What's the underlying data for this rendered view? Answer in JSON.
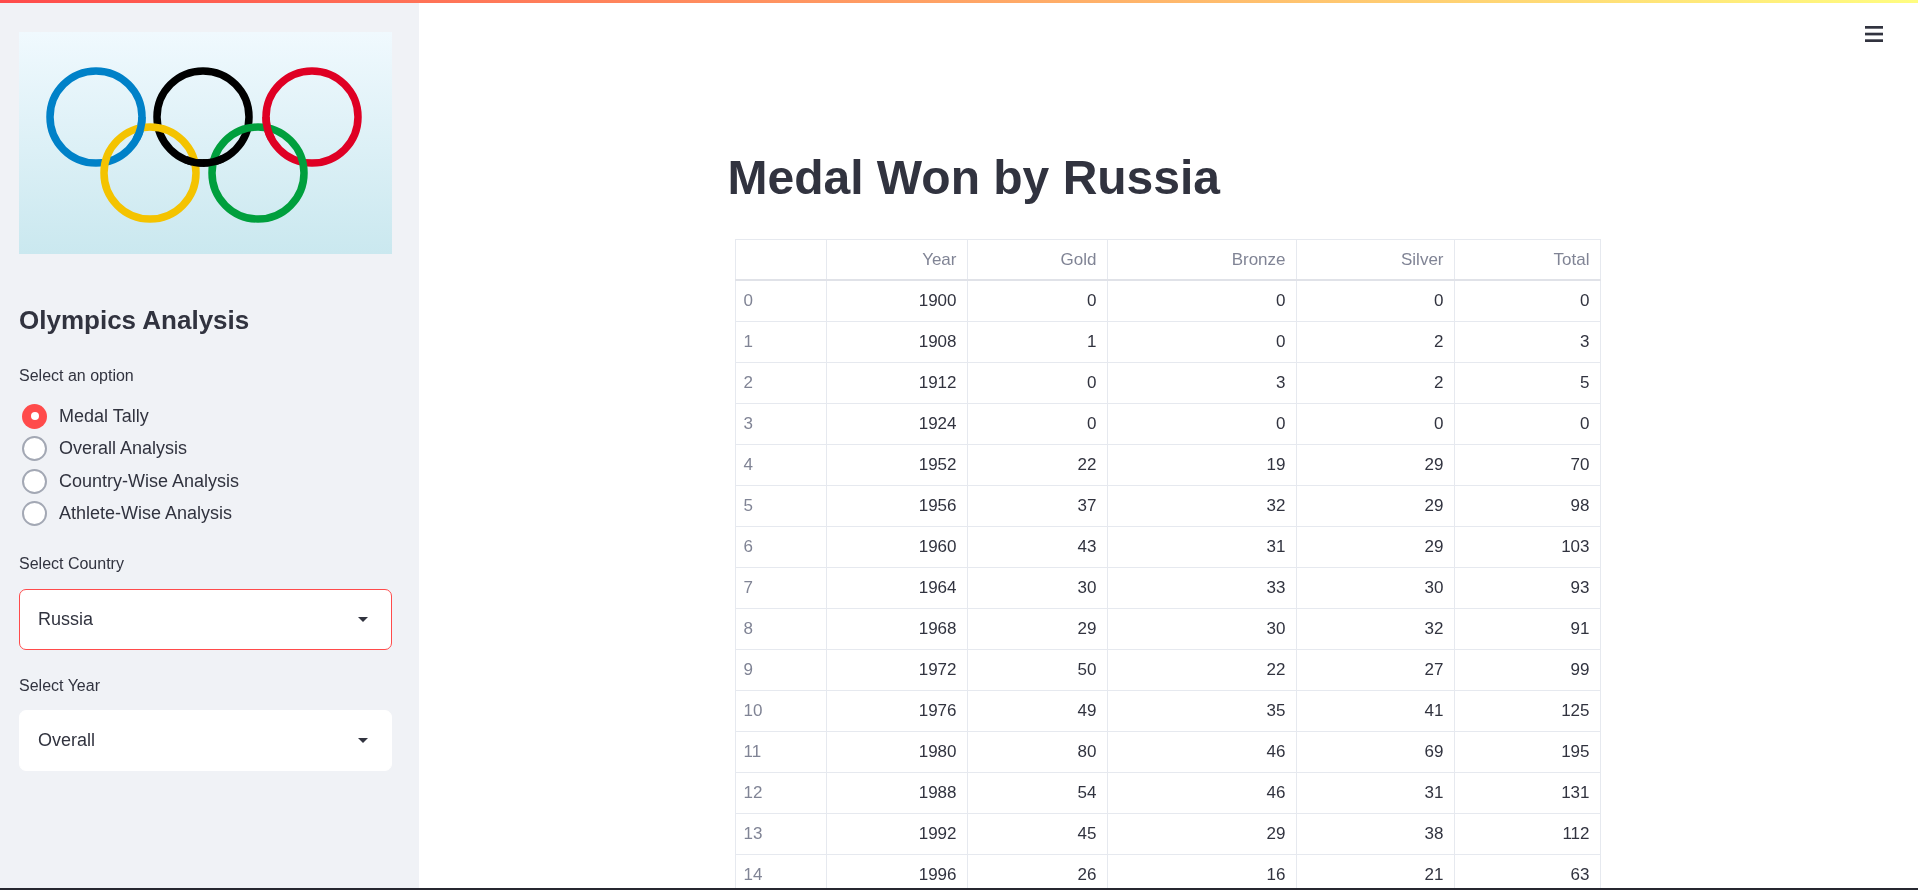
{
  "sidebar": {
    "title": "Olympics Analysis",
    "option_label": "Select an option",
    "options": [
      {
        "label": "Medal Tally",
        "selected": true
      },
      {
        "label": "Overall Analysis",
        "selected": false
      },
      {
        "label": "Country-Wise Analysis",
        "selected": false
      },
      {
        "label": "Athlete-Wise Analysis",
        "selected": false
      }
    ],
    "selects": [
      {
        "label": "Select Country",
        "value": "Russia",
        "focused": true
      },
      {
        "label": "Select Year",
        "value": "Overall",
        "focused": false
      }
    ]
  },
  "main": {
    "title": "Medal Won by Russia",
    "table": {
      "columns": [
        "Year",
        "Gold",
        "Bronze",
        "Silver",
        "Total"
      ],
      "rows": [
        {
          "index": "0",
          "cells": [
            "1900",
            "0",
            "0",
            "0",
            "0"
          ]
        },
        {
          "index": "1",
          "cells": [
            "1908",
            "1",
            "0",
            "2",
            "3"
          ]
        },
        {
          "index": "2",
          "cells": [
            "1912",
            "0",
            "3",
            "2",
            "5"
          ]
        },
        {
          "index": "3",
          "cells": [
            "1924",
            "0",
            "0",
            "0",
            "0"
          ]
        },
        {
          "index": "4",
          "cells": [
            "1952",
            "22",
            "19",
            "29",
            "70"
          ]
        },
        {
          "index": "5",
          "cells": [
            "1956",
            "37",
            "32",
            "29",
            "98"
          ]
        },
        {
          "index": "6",
          "cells": [
            "1960",
            "43",
            "31",
            "29",
            "103"
          ]
        },
        {
          "index": "7",
          "cells": [
            "1964",
            "30",
            "33",
            "30",
            "93"
          ]
        },
        {
          "index": "8",
          "cells": [
            "1968",
            "29",
            "30",
            "32",
            "91"
          ]
        },
        {
          "index": "9",
          "cells": [
            "1972",
            "50",
            "22",
            "27",
            "99"
          ]
        },
        {
          "index": "10",
          "cells": [
            "1976",
            "49",
            "35",
            "41",
            "125"
          ]
        },
        {
          "index": "11",
          "cells": [
            "1980",
            "80",
            "46",
            "69",
            "195"
          ]
        },
        {
          "index": "12",
          "cells": [
            "1988",
            "54",
            "46",
            "31",
            "131"
          ]
        },
        {
          "index": "13",
          "cells": [
            "1992",
            "45",
            "29",
            "38",
            "112"
          ]
        },
        {
          "index": "14",
          "cells": [
            "1996",
            "26",
            "16",
            "21",
            "63"
          ]
        }
      ]
    }
  }
}
